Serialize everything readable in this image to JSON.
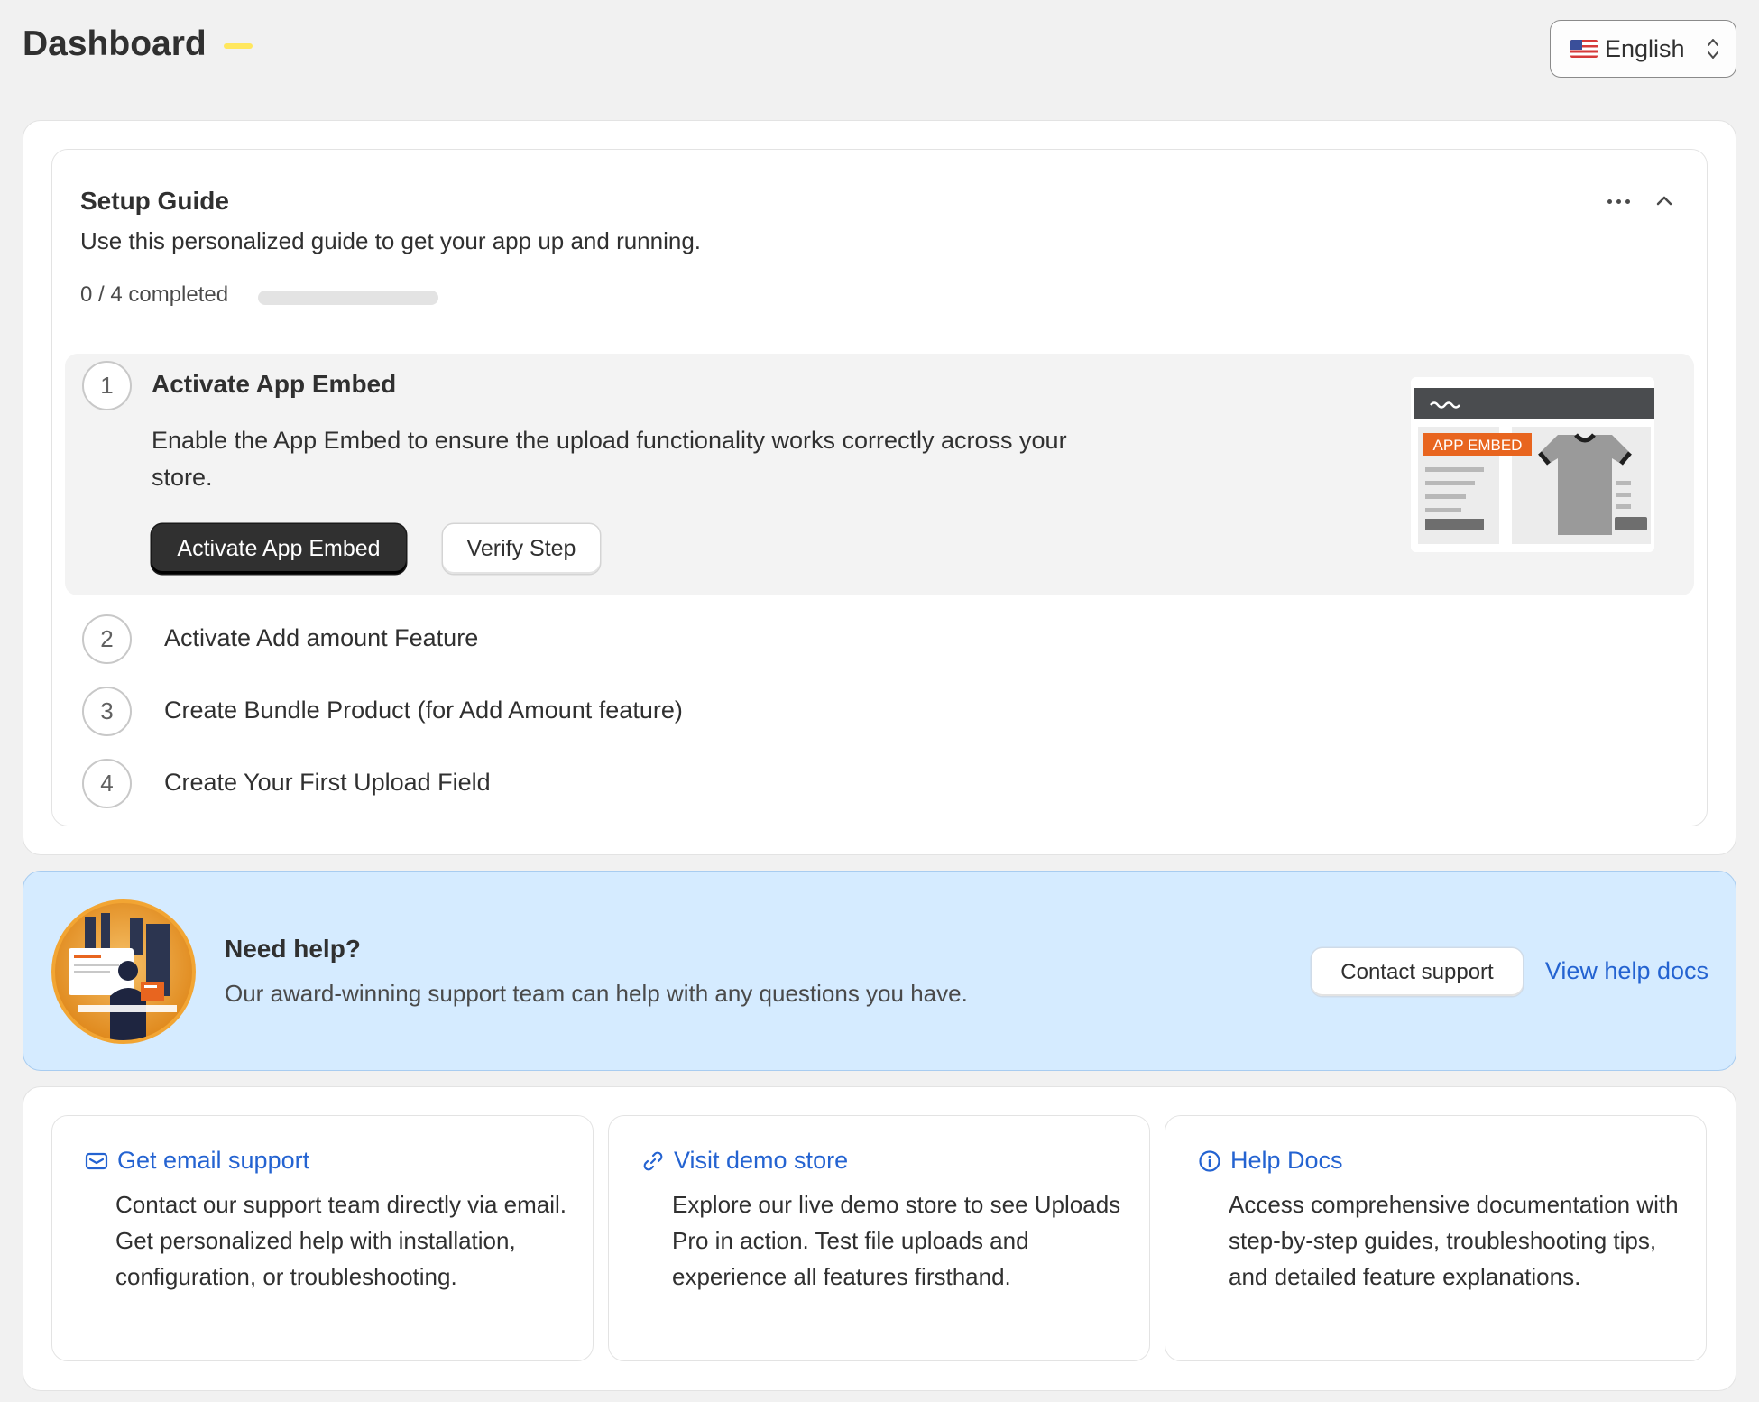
{
  "header": {
    "title": "Dashboard",
    "language": {
      "selected": "English",
      "flag_icon": "us-flag-icon"
    }
  },
  "setup_guide": {
    "title": "Setup Guide",
    "subtitle": "Use this personalized guide to get your app up and running.",
    "progress": {
      "label": "0 / 4 completed",
      "completed": 0,
      "total": 4
    },
    "steps": [
      {
        "number": "1",
        "title": "Activate App Embed",
        "description": "Enable the App Embed to ensure the upload functionality works correctly across your store.",
        "primary_button": "Activate App Embed",
        "secondary_button": "Verify Step",
        "illustration_badge": "APP EMBED"
      },
      {
        "number": "2",
        "title": "Activate Add amount Feature"
      },
      {
        "number": "3",
        "title": "Create Bundle Product (for Add Amount feature)"
      },
      {
        "number": "4",
        "title": "Create Your First Upload Field"
      }
    ]
  },
  "help_banner": {
    "title": "Need help?",
    "subtitle": "Our award-winning support team can help with any questions you have.",
    "contact_button": "Contact support",
    "docs_link": "View help docs"
  },
  "resources": [
    {
      "icon": "email-icon",
      "title": "Get email support",
      "description": "Contact our support team directly via email. Get personalized help with installation, configuration, or troubleshooting."
    },
    {
      "icon": "link-icon",
      "title": "Visit demo store",
      "description": "Explore our live demo store to see Uploads Pro in action. Test file uploads and experience all features firsthand."
    },
    {
      "icon": "info-icon",
      "title": "Help Docs",
      "description": "Access comprehensive documentation with step-by-step guides, troubleshooting tips, and detailed feature explanations."
    }
  ],
  "colors": {
    "page_bg": "#f1f1f1",
    "primary_button": "#303030",
    "link": "#2463d1",
    "help_bg": "#d5ebff",
    "title_accent": "#ffe75e",
    "badge": "#e8651f"
  }
}
